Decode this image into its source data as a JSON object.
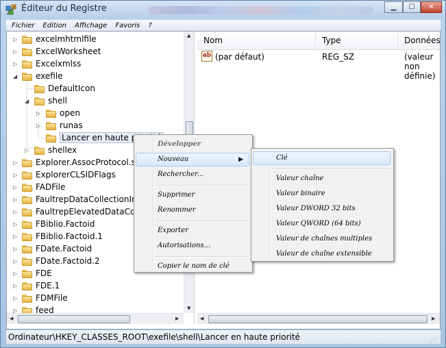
{
  "window": {
    "title": "Éditeur du Registre",
    "minimize_icon": "minimize-icon",
    "maximize_icon": "maximize-icon",
    "close_icon": "close-icon"
  },
  "menubar": [
    "Fichier",
    "Edition",
    "Affichage",
    "Favoris",
    "?"
  ],
  "tree": [
    {
      "label": "excelmhtmlfile",
      "level": 1,
      "expander": "closed"
    },
    {
      "label": "ExcelWorksheet",
      "level": 1,
      "expander": "closed"
    },
    {
      "label": "Excelxmlss",
      "level": 1,
      "expander": "closed"
    },
    {
      "label": "exefile",
      "level": 1,
      "expander": "open"
    },
    {
      "label": "DefaultIcon",
      "level": 2,
      "expander": "none"
    },
    {
      "label": "shell",
      "level": 2,
      "expander": "open"
    },
    {
      "label": "open",
      "level": 3,
      "expander": "closed"
    },
    {
      "label": "runas",
      "level": 3,
      "expander": "closed"
    },
    {
      "label": "Lancer en haute priorité",
      "level": 3,
      "expander": "none",
      "selected": true
    },
    {
      "label": "shellex",
      "level": 2,
      "expander": "closed"
    },
    {
      "label": "Explorer.AssocProtocol.search-ms",
      "level": 1,
      "expander": "closed"
    },
    {
      "label": "ExplorerCLSIDFlags",
      "level": 1,
      "expander": "closed"
    },
    {
      "label": "FADFile",
      "level": 1,
      "expander": "closed"
    },
    {
      "label": "FaultrepDataCollectionInProgress",
      "level": 1,
      "expander": "closed"
    },
    {
      "label": "FaultrepElevatedDataCollection",
      "level": 1,
      "expander": "closed"
    },
    {
      "label": "FBiblio.Factoid",
      "level": 1,
      "expander": "closed"
    },
    {
      "label": "FBiblio.Factoid.1",
      "level": 1,
      "expander": "closed"
    },
    {
      "label": "FDate.Factoid",
      "level": 1,
      "expander": "closed"
    },
    {
      "label": "FDate.Factoid.2",
      "level": 1,
      "expander": "closed"
    },
    {
      "label": "FDE",
      "level": 1,
      "expander": "closed"
    },
    {
      "label": "FDE.1",
      "level": 1,
      "expander": "closed"
    },
    {
      "label": "FDMFile",
      "level": 1,
      "expander": "closed"
    },
    {
      "label": "feed",
      "level": 1,
      "expander": "closed"
    }
  ],
  "list": {
    "columns": [
      "Nom",
      "Type",
      "Données"
    ],
    "rows": [
      {
        "name": "(par défaut)",
        "type": "REG_SZ",
        "data": "(valeur non définie)"
      }
    ]
  },
  "context_menu": [
    {
      "label": "Développer",
      "bold": true
    },
    {
      "label": "Nouveau",
      "highlighted": true,
      "submenu": true
    },
    {
      "label": "Rechercher..."
    },
    {
      "separator": true
    },
    {
      "label": "Supprimer"
    },
    {
      "label": "Renommer"
    },
    {
      "separator": true
    },
    {
      "label": "Exporter"
    },
    {
      "label": "Autorisations..."
    },
    {
      "separator": true
    },
    {
      "label": "Copier le nom de clé"
    }
  ],
  "submenu": [
    {
      "label": "Clé",
      "highlighted": true
    },
    {
      "separator": true
    },
    {
      "label": "Valeur chaîne"
    },
    {
      "label": "Valeur binaire"
    },
    {
      "label": "Valeur DWORD 32 bits"
    },
    {
      "label": "Valeur QWORD (64 bits)"
    },
    {
      "label": "Valeur de chaînes multiples"
    },
    {
      "label": "Valeur de chaîne extensible"
    }
  ],
  "status": "Ordinateur\\HKEY_CLASSES_ROOT\\exefile\\shell\\Lancer en haute priorité"
}
